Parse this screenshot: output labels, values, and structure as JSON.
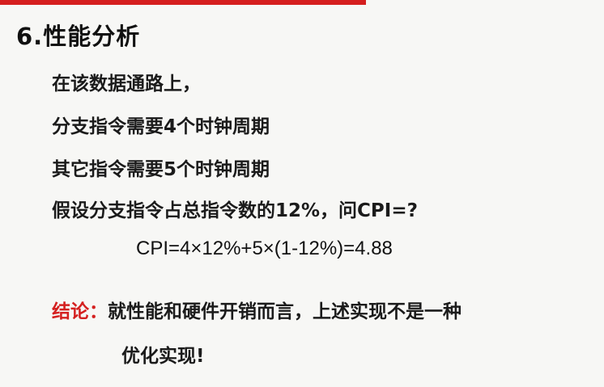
{
  "colors": {
    "accent_bar": "#d51f1f",
    "conclusion_label": "#d42020",
    "background": "#f7f7f5"
  },
  "slide": {
    "heading": "6.性能分析",
    "lines": [
      "在该数据通路上，",
      "分支指令需要4个时钟周期",
      "其它指令需要5个时钟周期",
      "假设分支指令占总指令数的12%，问CPI=?"
    ],
    "formula": "CPI=4×12%+5×(1-12%)=4.88",
    "conclusion_label": "结论：",
    "conclusion_text": "就性能和硬件开销而言，上述实现不是一种",
    "conclusion_continuation": "优化实现!"
  }
}
